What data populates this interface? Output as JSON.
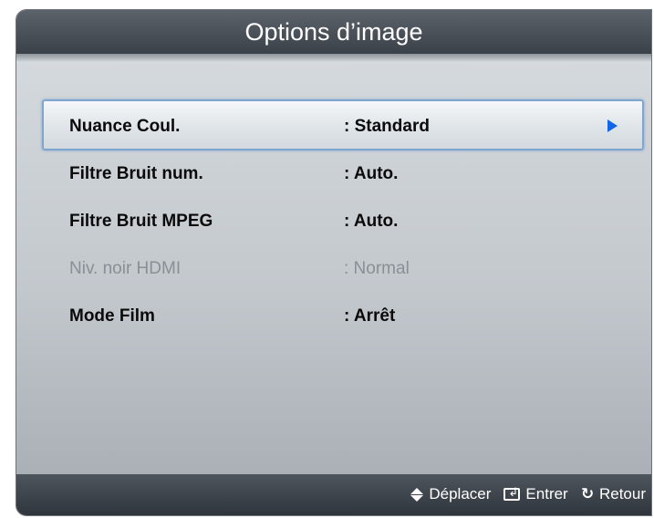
{
  "window": {
    "title": "Options d’image"
  },
  "menu": {
    "items": [
      {
        "label": "Nuance Coul.",
        "value": ": Standard",
        "selected": true,
        "enabled": true
      },
      {
        "label": "Filtre Bruit num.",
        "value": ": Auto.",
        "selected": false,
        "enabled": true
      },
      {
        "label": "Filtre Bruit MPEG",
        "value": ": Auto.",
        "selected": false,
        "enabled": true
      },
      {
        "label": "Niv. noir HDMI",
        "value": ": Normal",
        "selected": false,
        "enabled": false
      },
      {
        "label": "Mode Film",
        "value": ": Arrêt",
        "selected": false,
        "enabled": true
      }
    ],
    "submenu_icon": "right-triangle-icon",
    "selection_color": "#7fa6cf",
    "arrow_color": "#1466e6"
  },
  "footer": {
    "move": {
      "icon": "up-down-icon",
      "label": "Déplacer"
    },
    "enter": {
      "icon": "enter-icon",
      "label": "Entrer"
    },
    "back": {
      "icon": "return-icon",
      "label": "Retour"
    }
  }
}
